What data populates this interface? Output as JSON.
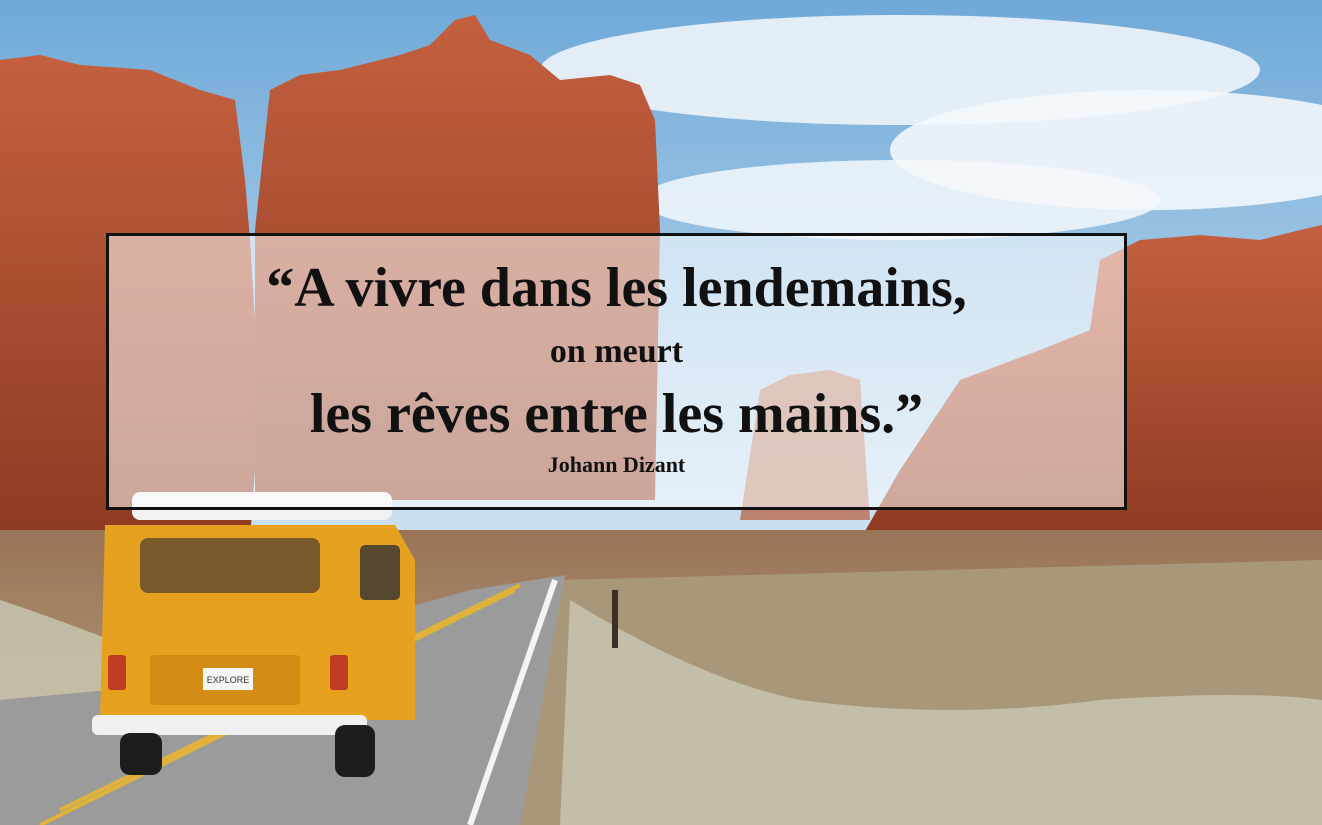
{
  "quote": {
    "line1": "“A vivre dans les lendemains,",
    "line2": "on meurt",
    "line3": "les rêves entre les mains.”",
    "author": "Johann Dizant"
  },
  "scene": {
    "van_plate": "EXPLORE"
  },
  "colors": {
    "sky": "#7fb6e0",
    "rock": "#b5563a",
    "van": "#e6a21f",
    "road": "#9e9e9e"
  }
}
